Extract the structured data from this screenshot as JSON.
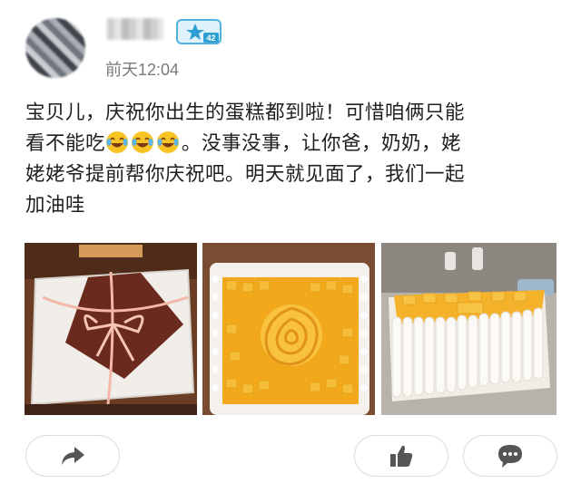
{
  "post": {
    "timestamp": "前天12:04",
    "text_line_1": "宝贝儿，庆祝你出生的蛋糕都到啦！可惜咱俩只能",
    "text_line_2_a": "看不能吃",
    "text_line_2_b": "。没事没事，让你爸，奶奶，姥",
    "text_line_3": "姥姥爷提前帮你庆祝吧。明天就见面了，我们一起",
    "text_line_4": "加油哇",
    "badge_number": "42"
  },
  "emoji": [
    "laughing-crying-emoji",
    "laughing-crying-emoji",
    "laughing-crying-emoji"
  ],
  "photos": [
    {
      "name": "gift-box-cake-photo"
    },
    {
      "name": "mango-rose-cake-photo"
    },
    {
      "name": "mango-cake-side-photo"
    }
  ],
  "actions": {
    "share_icon": "share-arrow-icon",
    "like_icon": "thumbs-up-icon",
    "comment_icon": "speech-bubble-icon"
  },
  "colors": {
    "timestamp": "#7a7a7a",
    "text": "#1e1e1e",
    "border": "#dcdcdc",
    "mango": "#f2a81b"
  }
}
